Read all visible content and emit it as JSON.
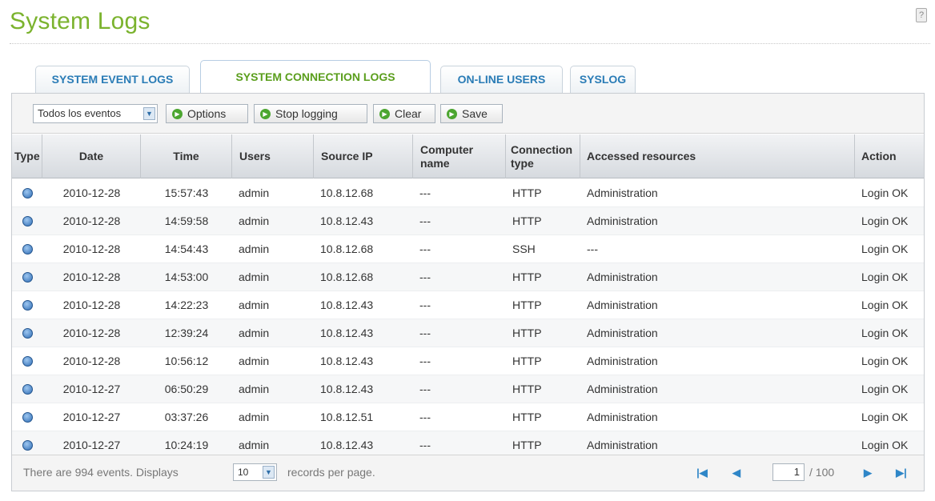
{
  "page": {
    "title": "System Logs",
    "help_icon": "?"
  },
  "tabs": [
    {
      "label": "SYSTEM EVENT LOGS",
      "active": false
    },
    {
      "label": "SYSTEM CONNECTION LOGS",
      "active": true
    },
    {
      "label": "ON-LINE USERS",
      "active": false
    },
    {
      "label": "SYSLOG",
      "active": false
    }
  ],
  "toolbar": {
    "filter_value": "Todos los eventos",
    "options_label": "Options",
    "stop_label": "Stop logging",
    "clear_label": "Clear",
    "save_label": "Save",
    "button_icon": "green-arrow-circle-icon"
  },
  "table": {
    "headers": [
      "Type",
      "Date",
      "Time",
      "Users",
      "Source IP",
      "Computer name",
      "Connection type",
      "Accessed resources",
      "Action"
    ],
    "type_icon": "info-icon",
    "rows": [
      {
        "date": "2010-12-28",
        "time": "15:57:43",
        "user": "admin",
        "ip": "10.8.12.68",
        "computer": "---",
        "conn": "HTTP",
        "resource": "Administration",
        "action": "Login OK"
      },
      {
        "date": "2010-12-28",
        "time": "14:59:58",
        "user": "admin",
        "ip": "10.8.12.43",
        "computer": "---",
        "conn": "HTTP",
        "resource": "Administration",
        "action": "Login OK"
      },
      {
        "date": "2010-12-28",
        "time": "14:54:43",
        "user": "admin",
        "ip": "10.8.12.68",
        "computer": "---",
        "conn": "SSH",
        "resource": "---",
        "action": "Login OK"
      },
      {
        "date": "2010-12-28",
        "time": "14:53:00",
        "user": "admin",
        "ip": "10.8.12.68",
        "computer": "---",
        "conn": "HTTP",
        "resource": "Administration",
        "action": "Login OK"
      },
      {
        "date": "2010-12-28",
        "time": "14:22:23",
        "user": "admin",
        "ip": "10.8.12.43",
        "computer": "---",
        "conn": "HTTP",
        "resource": "Administration",
        "action": "Login OK"
      },
      {
        "date": "2010-12-28",
        "time": "12:39:24",
        "user": "admin",
        "ip": "10.8.12.43",
        "computer": "---",
        "conn": "HTTP",
        "resource": "Administration",
        "action": "Login OK"
      },
      {
        "date": "2010-12-28",
        "time": "10:56:12",
        "user": "admin",
        "ip": "10.8.12.43",
        "computer": "---",
        "conn": "HTTP",
        "resource": "Administration",
        "action": "Login OK"
      },
      {
        "date": "2010-12-27",
        "time": "06:50:29",
        "user": "admin",
        "ip": "10.8.12.43",
        "computer": "---",
        "conn": "HTTP",
        "resource": "Administration",
        "action": "Login OK"
      },
      {
        "date": "2010-12-27",
        "time": "03:37:26",
        "user": "admin",
        "ip": "10.8.12.51",
        "computer": "---",
        "conn": "HTTP",
        "resource": "Administration",
        "action": "Login OK"
      },
      {
        "date": "2010-12-27",
        "time": "10:24:19",
        "user": "admin",
        "ip": "10.8.12.43",
        "computer": "---",
        "conn": "HTTP",
        "resource": "Administration",
        "action": "Login OK"
      }
    ]
  },
  "footer": {
    "events_text": "There are 994 events. Displays",
    "per_page_value": "10",
    "records_text": "records per page.",
    "current_page": "1",
    "total_pages": "/ 100"
  },
  "colors": {
    "title": "#7bb32e",
    "tab_text": "#2a7cb6",
    "tab_active_text": "#5a9e1c",
    "accent_blue": "#2f86c7"
  }
}
